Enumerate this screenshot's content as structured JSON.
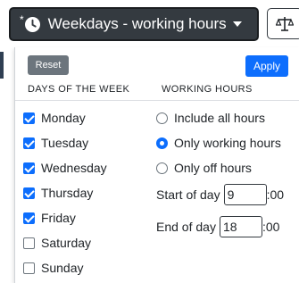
{
  "toolbar": {
    "modified_marker": "*",
    "filter_label": "Weekdays - working hours",
    "filter_icon": "clock-icon",
    "dropdown_icon": "caret-down-icon",
    "side_icon": "balance-scale-icon"
  },
  "panel": {
    "reset_label": "Reset",
    "apply_label": "Apply",
    "days_header": "DAYS OF THE WEEK",
    "hours_header": "WORKING HOURS",
    "days": [
      {
        "label": "Monday",
        "checked": true
      },
      {
        "label": "Tuesday",
        "checked": true
      },
      {
        "label": "Wednesday",
        "checked": true
      },
      {
        "label": "Thursday",
        "checked": true
      },
      {
        "label": "Friday",
        "checked": true
      },
      {
        "label": "Saturday",
        "checked": false
      },
      {
        "label": "Sunday",
        "checked": false
      }
    ],
    "hour_options": [
      {
        "label": "Include all hours",
        "selected": false
      },
      {
        "label": "Only working hours",
        "selected": true
      },
      {
        "label": "Only off hours",
        "selected": false
      }
    ],
    "start_label": "Start of day",
    "start_value": "9",
    "end_label": "End of day",
    "end_value": "18",
    "minutes_suffix": ":00"
  },
  "colors": {
    "primary": "#0d6efd",
    "secondary": "#6c757d",
    "dark": "#343a40"
  }
}
